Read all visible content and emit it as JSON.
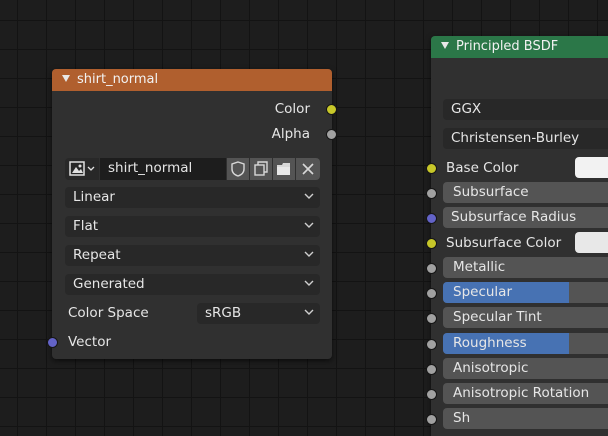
{
  "image_node": {
    "title": "shirt_normal",
    "header_color": "#b05f2e",
    "outputs": [
      {
        "label": "Color",
        "socket": "yellow"
      },
      {
        "label": "Alpha",
        "socket": "grey"
      }
    ],
    "image_name": "shirt_normal",
    "interpolation": "Linear",
    "projection": "Flat",
    "extension": "Repeat",
    "source": "Generated",
    "color_space_label": "Color Space",
    "color_space": "sRGB",
    "vector_label": "Vector"
  },
  "bsdf_node": {
    "title": "Principled BSDF",
    "header_color": "#2b7748",
    "distribution": "GGX",
    "subsurface_method": "Christensen-Burley",
    "inputs": [
      {
        "label": "Base Color",
        "kind": "color",
        "color": "#f2f2f2"
      },
      {
        "label": "Subsurface",
        "kind": "value"
      },
      {
        "label": "Subsurface Radius",
        "kind": "vector"
      },
      {
        "label": "Subsurface Color",
        "kind": "color",
        "color": "#e8e8e8"
      },
      {
        "label": "Metallic",
        "kind": "value"
      },
      {
        "label": "Specular",
        "kind": "slider",
        "fraction": 0.5
      },
      {
        "label": "Specular Tint",
        "kind": "value"
      },
      {
        "label": "Roughness",
        "kind": "slider",
        "fraction": 0.5
      },
      {
        "label": "Anisotropic",
        "kind": "value"
      },
      {
        "label": "Anisotropic Rotation",
        "kind": "value"
      },
      {
        "label": "Sh",
        "kind": "value"
      }
    ]
  }
}
